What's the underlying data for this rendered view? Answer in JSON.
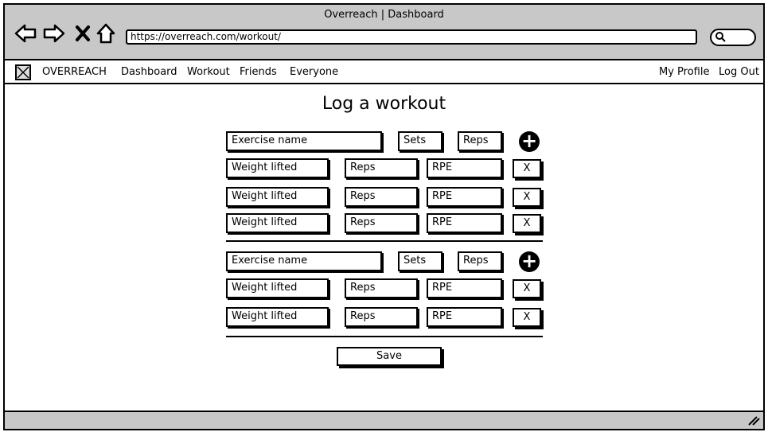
{
  "browser": {
    "title": "Overreach | Dashboard",
    "url": "https://overreach.com/workout/"
  },
  "nav": {
    "brand": "OVERREACH",
    "links": [
      "Dashboard",
      "Workout",
      "Friends",
      "Everyone"
    ],
    "right_links": [
      "My Profile",
      "Log Out"
    ]
  },
  "page": {
    "title": "Log a workout",
    "exercises": [
      {
        "name_placeholder": "Exercise name",
        "sets_placeholder": "Sets",
        "reps_placeholder": "Reps",
        "rows": [
          {
            "weight": "Weight lifted",
            "reps": "Reps",
            "rpe": "RPE",
            "remove": "X"
          },
          {
            "weight": "Weight lifted",
            "reps": "Reps",
            "rpe": "RPE",
            "remove": "X"
          },
          {
            "weight": "Weight lifted",
            "reps": "Reps",
            "rpe": "RPE",
            "remove": "X"
          }
        ]
      },
      {
        "name_placeholder": "Exercise name",
        "sets_placeholder": "Sets",
        "reps_placeholder": "Reps",
        "rows": [
          {
            "weight": "Weight lifted",
            "reps": "Reps",
            "rpe": "RPE",
            "remove": "X"
          },
          {
            "weight": "Weight lifted",
            "reps": "Reps",
            "rpe": "RPE",
            "remove": "X"
          }
        ]
      }
    ],
    "save_label": "Save"
  },
  "icons": {
    "back": "back-arrow-icon",
    "forward": "forward-arrow-icon",
    "stop": "close-icon",
    "home": "home-icon",
    "search": "search-icon",
    "add": "plus-circle-icon",
    "logo": "image-placeholder-icon",
    "resize": "resize-grip-icon"
  }
}
